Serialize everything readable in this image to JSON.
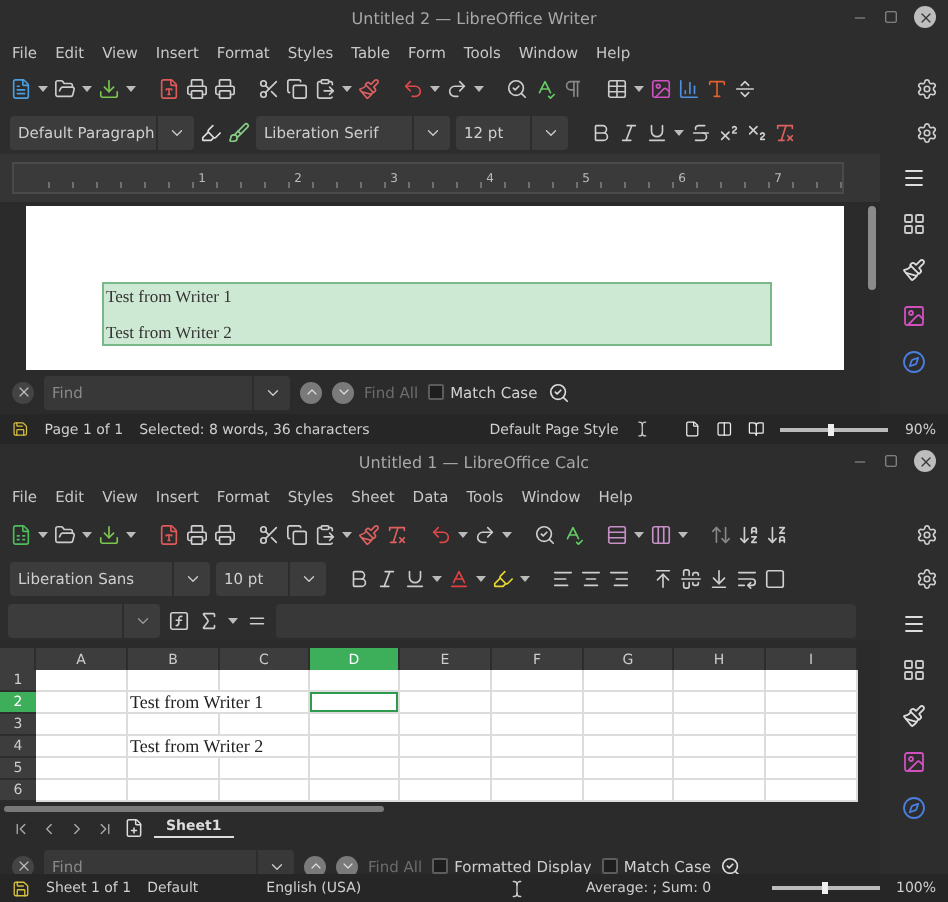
{
  "writer": {
    "title": "Untitled 2 — LibreOffice Writer",
    "menu": [
      "File",
      "Edit",
      "View",
      "Insert",
      "Format",
      "Styles",
      "Table",
      "Form",
      "Tools",
      "Window",
      "Help"
    ],
    "paragraph_style": "Default Paragraph",
    "font_name": "Liberation Serif",
    "font_size": "12 pt",
    "ruler_numbers": [
      "1",
      "2",
      "3",
      "4",
      "5",
      "6",
      "7"
    ],
    "document_lines": [
      "Test from Writer 1",
      "Test from Writer 2"
    ],
    "find": {
      "placeholder": "Find",
      "find_all": {
        "label": "Find All",
        "disabled": true
      },
      "options": [
        {
          "label": "Match Case",
          "checked": false
        }
      ]
    },
    "status_bar": {
      "page": "Page 1 of 1",
      "selection": "Selected: 8 words, 36 characters",
      "page_style": "Default Page Style",
      "zoom_slider": {
        "level": 0.47
      },
      "zoom": "90%"
    }
  },
  "calc": {
    "title": "Untitled 1 — LibreOffice Calc",
    "menu": [
      "File",
      "Edit",
      "View",
      "Insert",
      "Format",
      "Styles",
      "Sheet",
      "Data",
      "Tools",
      "Window",
      "Help"
    ],
    "font_name": "Liberation Sans",
    "font_size": "10 pt",
    "columns": [
      {
        "label": "A",
        "selected": false
      },
      {
        "label": "B",
        "selected": false
      },
      {
        "label": "C",
        "selected": false
      },
      {
        "label": "D",
        "selected": true
      },
      {
        "label": "E",
        "selected": false
      },
      {
        "label": "F",
        "selected": false
      },
      {
        "label": "G",
        "selected": false
      },
      {
        "label": "H",
        "selected": false
      },
      {
        "label": "I",
        "selected": false
      }
    ],
    "rows": [
      {
        "label": "1",
        "selected": false
      },
      {
        "label": "2",
        "selected": true,
        "column_b": "Test from Writer 1"
      },
      {
        "label": "3",
        "selected": false
      },
      {
        "label": "4",
        "selected": false,
        "column_b": "Test from Writer 2"
      },
      {
        "label": "5",
        "selected": false
      },
      {
        "label": "6",
        "selected": false
      }
    ],
    "sheet_tabs": [
      {
        "label": "Sheet1",
        "selected": true
      }
    ],
    "find": {
      "placeholder": "Find",
      "find_all": {
        "label": "Find All",
        "disabled": true
      },
      "options": [
        {
          "label": "Formatted Display",
          "checked": false
        },
        {
          "label": "Match Case",
          "checked": false
        }
      ]
    },
    "status_bar": {
      "sheet": "Sheet 1 of 1",
      "page_style": "Default",
      "language": "English (USA)",
      "summary": "Average: ; Sum: 0",
      "zoom_slider": {
        "level": 0.5
      },
      "zoom": "100%"
    }
  }
}
